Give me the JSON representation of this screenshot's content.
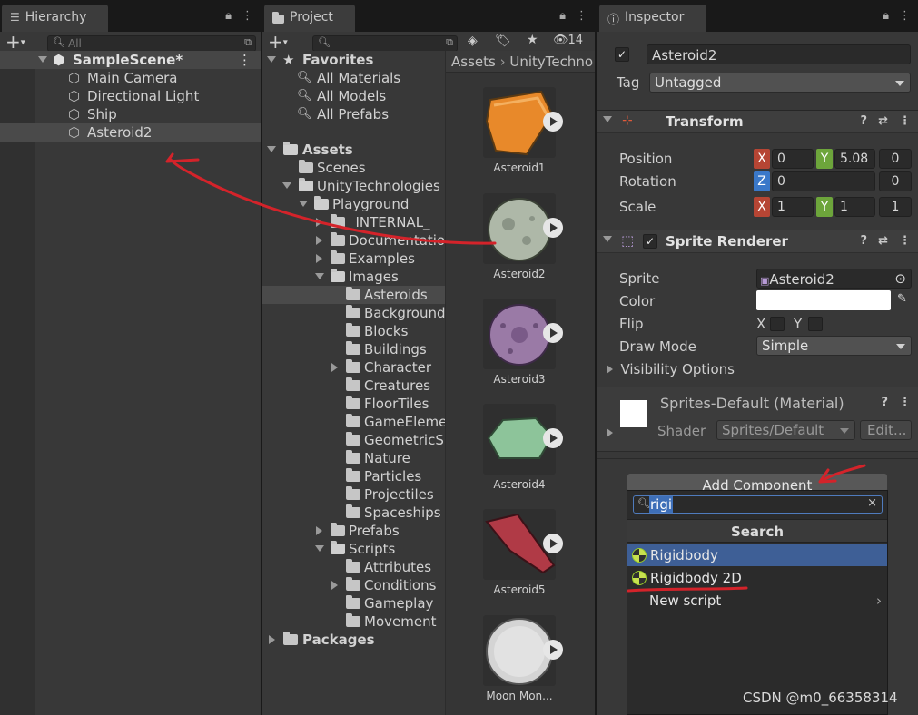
{
  "hierarchy": {
    "tab": "Hierarchy",
    "search_placeholder": "All",
    "scene": "SampleScene*",
    "objects": [
      "Main Camera",
      "Directional Light",
      "Ship",
      "Asteroid2"
    ]
  },
  "project": {
    "tab": "Project",
    "hidden_count": "14",
    "favorites": {
      "label": "Favorites",
      "items": [
        "All Materials",
        "All Models",
        "All Prefabs"
      ]
    },
    "tree": {
      "assets": "Assets",
      "scenes": "Scenes",
      "unity": "UnityTechnologies",
      "playground": "Playground",
      "internal": "_INTERNAL_",
      "documentation": "Documentation",
      "examples": "Examples",
      "images": "Images",
      "image_folders": [
        "Asteroids",
        "Background",
        "Blocks",
        "Buildings",
        "Character",
        "Creatures",
        "FloorTiles",
        "GameEleme",
        "GeometricSI",
        "Nature",
        "Particles",
        "Projectiles",
        "Spaceships"
      ],
      "prefabs": "Prefabs",
      "scripts": "Scripts",
      "script_folders": [
        "Attributes",
        "Conditions",
        "Gameplay",
        "Movement"
      ],
      "packages": "Packages"
    },
    "breadcrumb": [
      "Assets",
      "UnityTechno"
    ],
    "assets": [
      "Asteroid1",
      "Asteroid2",
      "Asteroid3",
      "Asteroid4",
      "Asteroid5",
      "Moon Mon..."
    ]
  },
  "inspector": {
    "tab": "Inspector",
    "object_name": "Asteroid2",
    "tag_label": "Tag",
    "tag_value": "Untagged",
    "transform": {
      "title": "Transform",
      "position_label": "Position",
      "rotation_label": "Rotation",
      "scale_label": "Scale",
      "position": {
        "x": "0",
        "y": "5.08",
        "z": "0"
      },
      "rotation": {
        "z": "0",
        "w": "0"
      },
      "scale": {
        "x": "1",
        "y": "1",
        "z": "1"
      }
    },
    "sprite_renderer": {
      "title": "Sprite Renderer",
      "sprite_label": "Sprite",
      "sprite_value": "Asteroid2",
      "color_label": "Color",
      "flip_label": "Flip",
      "flip_x": "X",
      "flip_y": "Y",
      "draw_mode_label": "Draw Mode",
      "draw_mode_value": "Simple",
      "visibility": "Visibility Options"
    },
    "material": {
      "name": "Sprites-Default (Material)",
      "shader_label": "Shader",
      "shader_value": "Sprites/Default",
      "edit_label": "Edit..."
    },
    "add_component": "Add Component",
    "popup": {
      "search_value": "rigi",
      "header": "Search",
      "items": [
        "Rigidbody",
        "Rigidbody 2D"
      ],
      "new_script": "New script"
    }
  },
  "watermark": "CSDN @m0_66358314",
  "colors": {
    "annotation": "#d4232a",
    "selection_blue": "#3e5f96",
    "axis_x": "#b64534",
    "axis_y": "#6da53b",
    "axis_z": "#3a78c9"
  }
}
